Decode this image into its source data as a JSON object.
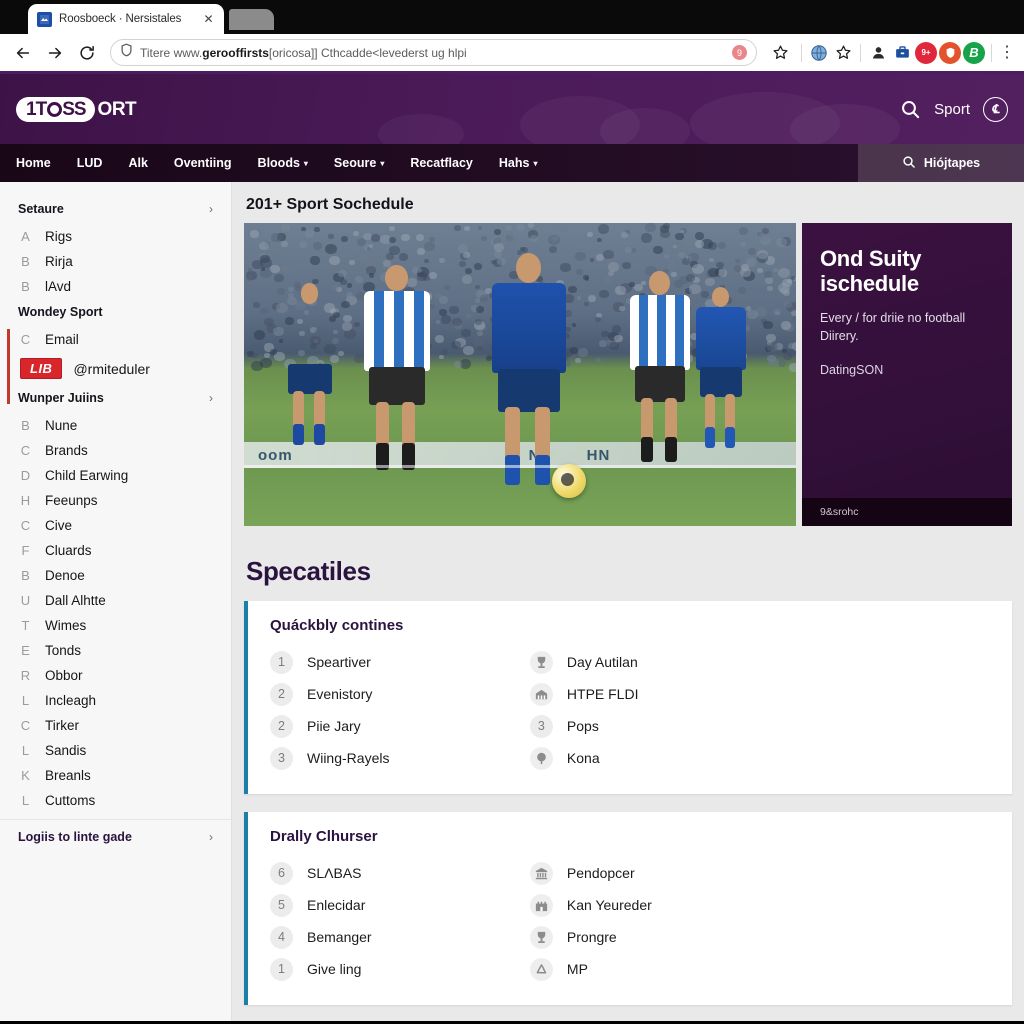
{
  "browser": {
    "tab": {
      "title": "Roosboeck · Nersistales",
      "close_label": "✕",
      "favicon": "page-favicon"
    },
    "new_tab_label": "",
    "back_label": "←",
    "forward_label": "→",
    "reload_label": "⟳",
    "omnibox": {
      "prefix": "Titere www.",
      "domain": "gerooffirsts",
      "suffix": "[oricosa]] Cthcadde<levederst ug hlpi",
      "placeholder": "Search or type a URL",
      "site_info_icon": "shield-icon",
      "tracker_badge": "9",
      "bookmark_icon": "star-icon"
    },
    "extensions": [
      {
        "name": "globe-extension-icon",
        "color": "#6e9fd4",
        "glyph": "◍"
      },
      {
        "name": "bookmark-star-icon",
        "color": "#ffffff",
        "glyph": "☆"
      },
      {
        "name": "profile-extension-icon",
        "color": "#2a2a2a",
        "glyph": "▰"
      },
      {
        "name": "briefcase-extension-icon",
        "color": "#1d4f9e",
        "glyph": "▮"
      },
      {
        "name": "red-badge-extension-icon",
        "color": "#e0273c",
        "glyph": "9+"
      },
      {
        "name": "orange-shield-extension-icon",
        "color": "#e2522c",
        "glyph": "◑"
      },
      {
        "name": "green-extension-icon",
        "color": "#16a34a",
        "glyph": "ℬ"
      }
    ],
    "menu_label": "⋮"
  },
  "site_header": {
    "logo_mark": "1T",
    "logo_mid": "SS",
    "logo_tail": "ORT",
    "search_icon": "search-icon",
    "sport_label": "Sport",
    "avatar_glyph": "℄",
    "accent_color": "#4b1a58"
  },
  "nav": {
    "items": [
      {
        "label": "Home",
        "caret": false
      },
      {
        "label": "LUD",
        "caret": false
      },
      {
        "label": "Alk",
        "caret": false
      },
      {
        "label": "Oventiing",
        "caret": false
      },
      {
        "label": "Bloods",
        "caret": true
      },
      {
        "label": "Seoure",
        "caret": true
      },
      {
        "label": "Recatflacy",
        "caret": false
      },
      {
        "label": "Hahs",
        "caret": true
      }
    ],
    "caret_glyph": "▾",
    "search": {
      "icon": "search-icon",
      "label": "Hiójtapes"
    }
  },
  "sidebar": {
    "sections": [
      {
        "heading": "Setaure",
        "chevron": "›",
        "items": [
          {
            "key": "A",
            "label": "Rigs"
          },
          {
            "key": "B",
            "label": "Rirja"
          },
          {
            "key": "B",
            "label": "lAvd"
          }
        ]
      },
      {
        "heading": "Wondey Sport",
        "chevron": "",
        "items": [
          {
            "key": "C",
            "label": "Email"
          }
        ],
        "badge": {
          "text": "LIB",
          "handle": "@rmiteduler"
        }
      },
      {
        "heading": "Wunper Juiins",
        "chevron": "›",
        "items": [
          {
            "key": "B",
            "label": "Nune"
          },
          {
            "key": "C",
            "label": "Brands"
          },
          {
            "key": "D",
            "label": "Child Earwing"
          },
          {
            "key": "H",
            "label": "Feeunps"
          },
          {
            "key": "C",
            "label": "Cive"
          },
          {
            "key": "F",
            "label": "Cluards"
          },
          {
            "key": "B",
            "label": "Denoe"
          },
          {
            "key": "U",
            "label": "Dall Alhtte"
          },
          {
            "key": "T",
            "label": "Wimes"
          },
          {
            "key": "E",
            "label": "Tonds"
          },
          {
            "key": "R",
            "label": "Obbor"
          },
          {
            "key": "L",
            "label": "Incleagh"
          },
          {
            "key": "C",
            "label": "Tirker"
          },
          {
            "key": "L",
            "label": "Sandis"
          },
          {
            "key": "K",
            "label": "Breanls"
          },
          {
            "key": "L",
            "label": "Cuttoms"
          }
        ]
      }
    ],
    "footer": {
      "label": "Logiis to linte gade",
      "chevron": "›"
    }
  },
  "main": {
    "title": "201+ Sport Sochedule",
    "hero": {
      "photo_alt": "football-match-photo",
      "adboard_text_1": "oom",
      "adboard_text_2": "NT",
      "adboard_text_3": "HN"
    },
    "promo": {
      "title": "Ond Suity ischedule",
      "subtitle": "Every / for driie no football Diirery.",
      "tag": "DatingSON",
      "footer": "9&srohc"
    },
    "section_title": "Specatiles",
    "panels": [
      {
        "title": "Quáckbly contines",
        "left_rows": [
          {
            "badge": "1",
            "label": "Speartiver"
          },
          {
            "badge": "2",
            "label": "Evenistory"
          },
          {
            "badge": "2",
            "label": "Piie Jary"
          },
          {
            "badge": "3",
            "label": "Wiing-Rayels"
          }
        ],
        "right_rows": [
          {
            "icon": "trophy-icon",
            "badge": "",
            "label": "Day Autilan"
          },
          {
            "icon": "stadium-icon",
            "badge": "",
            "label": "HTPE FLDI"
          },
          {
            "icon": "",
            "badge": "3",
            "label": "Pops"
          },
          {
            "icon": "tree-icon",
            "badge": "",
            "label": "Kona"
          }
        ]
      },
      {
        "title": "Drally Clhurser",
        "left_rows": [
          {
            "badge": "6",
            "label": "SLΛBAS"
          },
          {
            "badge": "5",
            "label": "Enlecidar"
          },
          {
            "badge": "4",
            "label": "Bemanger"
          },
          {
            "badge": "1",
            "label": "Give ling"
          }
        ],
        "right_rows": [
          {
            "icon": "bank-icon",
            "badge": "",
            "label": "Pendopcer"
          },
          {
            "icon": "castle-icon",
            "badge": "",
            "label": "Kan Yeureder"
          },
          {
            "icon": "trophy-icon",
            "badge": "",
            "label": "Prongre"
          },
          {
            "icon": "recycle-icon",
            "badge": "",
            "label": "MP"
          }
        ]
      }
    ]
  }
}
